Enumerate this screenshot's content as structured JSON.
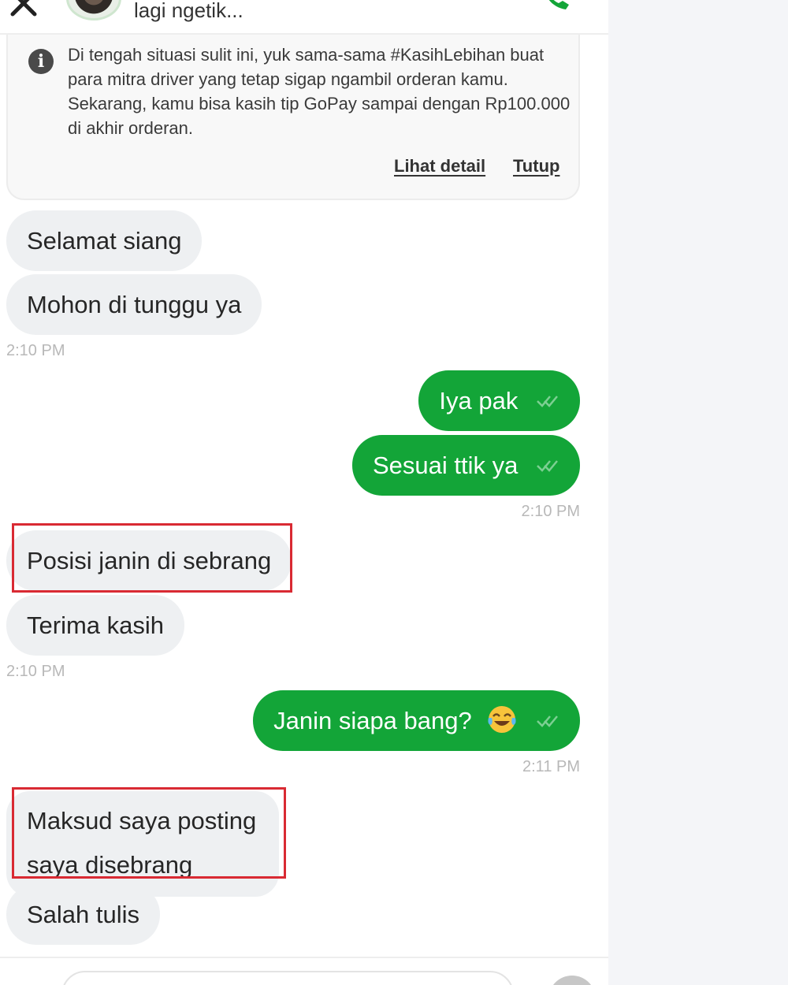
{
  "header": {
    "status": "lagi ngetik..."
  },
  "info_card": {
    "text": "Di tengah situasi sulit ini, yuk sama-sama #KasihLebihan buat para mitra driver yang tetap sigap ngambil orderan kamu. Sekarang, kamu bisa kasih tip GoPay sampai dengan Rp100.000 di akhir orderan.",
    "detail_link": "Lihat detail",
    "close_link": "Tutup"
  },
  "messages": {
    "m1": "Selamat siang",
    "m2": "Mohon di tunggu ya",
    "t1": "2:10 PM",
    "m3": "Iya pak",
    "m4": "Sesuai ttik ya",
    "t2": "2:10 PM",
    "m5": "Posisi janin di sebrang",
    "m6": "Terima kasih",
    "t3": "2:10 PM",
    "m7": "Janin siapa bang?",
    "t4": "2:11 PM",
    "m8": "Maksud saya posting saya disebrang",
    "m9": "Salah tulis"
  },
  "icons": {
    "close": "close-icon",
    "call": "phone-icon",
    "info": "info-icon",
    "read_receipt": "double-check-icon",
    "emoji": "tears-of-joy-emoji"
  },
  "colors": {
    "outgoing_bubble": "#13a538",
    "incoming_bubble": "#eef0f2",
    "highlight_box": "#d92a33",
    "brand_green": "#13a538"
  }
}
